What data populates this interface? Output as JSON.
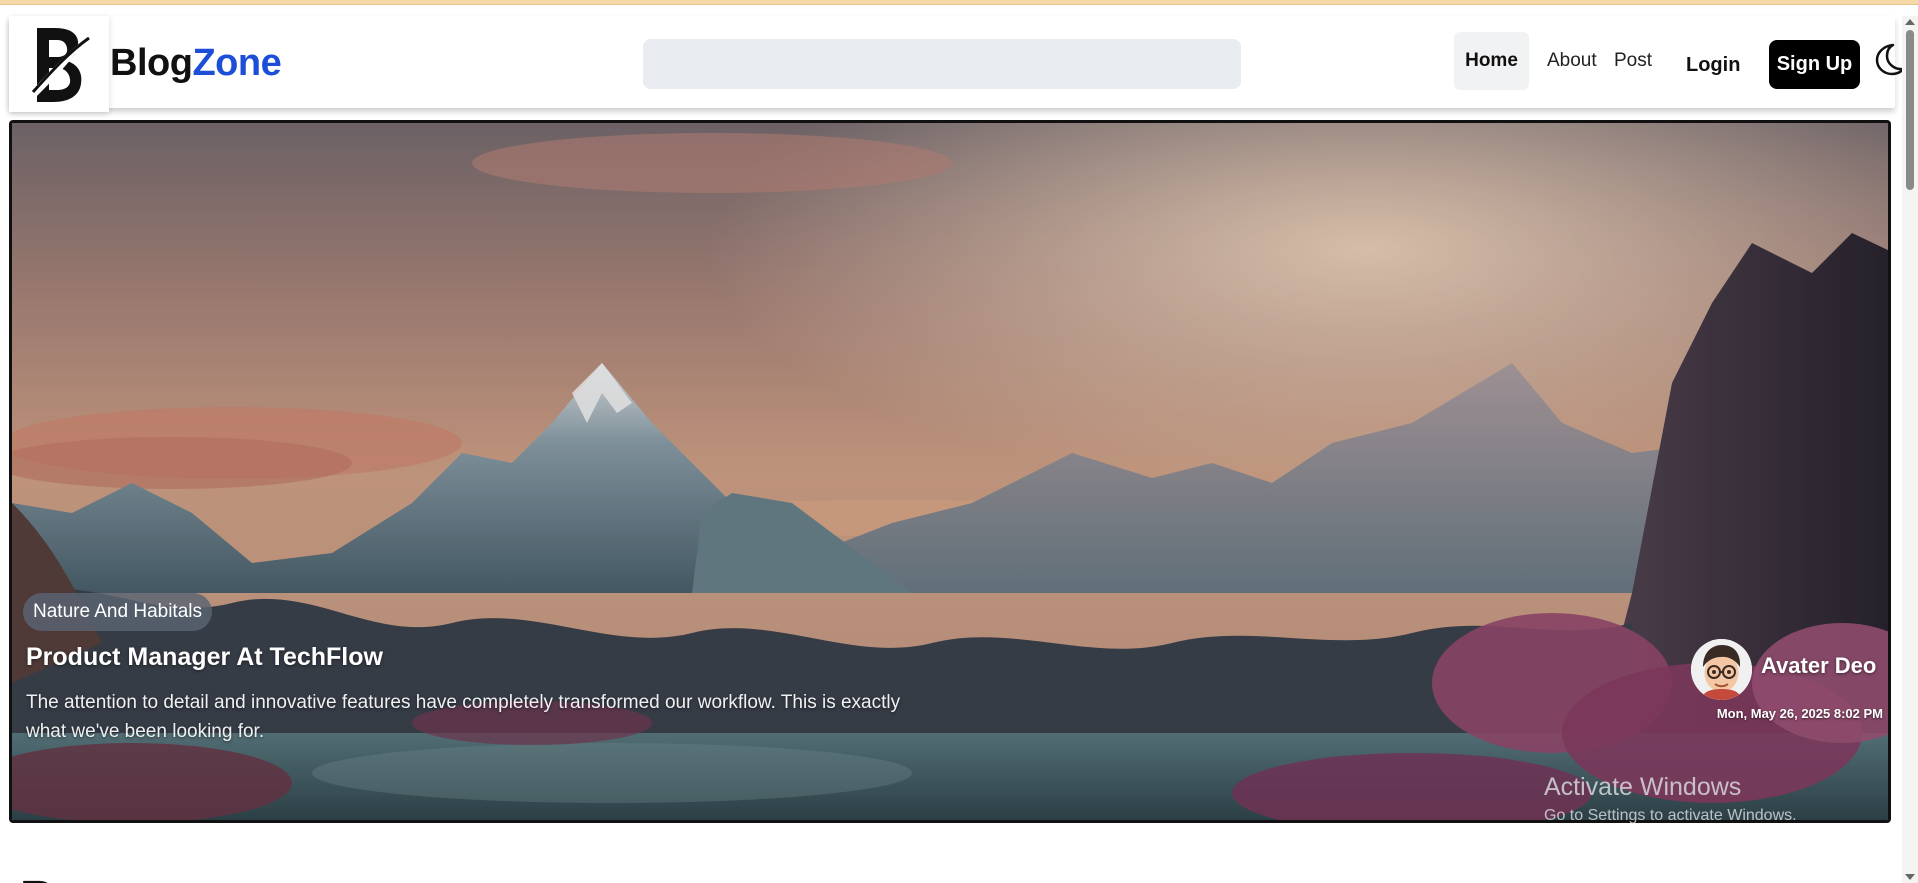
{
  "brand": {
    "part1": "Blog",
    "part2": "Zone",
    "accent_color": "#1d4ed8"
  },
  "search": {
    "placeholder": "",
    "value": ""
  },
  "nav": {
    "links": [
      {
        "label": "Home",
        "active": true
      },
      {
        "label": "About",
        "active": false
      },
      {
        "label": "Post",
        "active": false
      }
    ],
    "login_label": "Login",
    "signup_label": "Sign Up",
    "theme_toggle_icon": "moon-icon"
  },
  "hero": {
    "category": "Nature And Habitals",
    "title": "Product Manager At TechFlow",
    "description": "The attention to detail and innovative features have completely transformed our workflow. This is exactly what we've been looking for.",
    "author": "Avater Deo",
    "date": "Mon, May 26, 2025 8:02 PM"
  },
  "watermark": {
    "title": "Activate Windows",
    "subtitle": "Go to Settings to activate Windows."
  },
  "next_section": {
    "heading_glyph": "B"
  }
}
